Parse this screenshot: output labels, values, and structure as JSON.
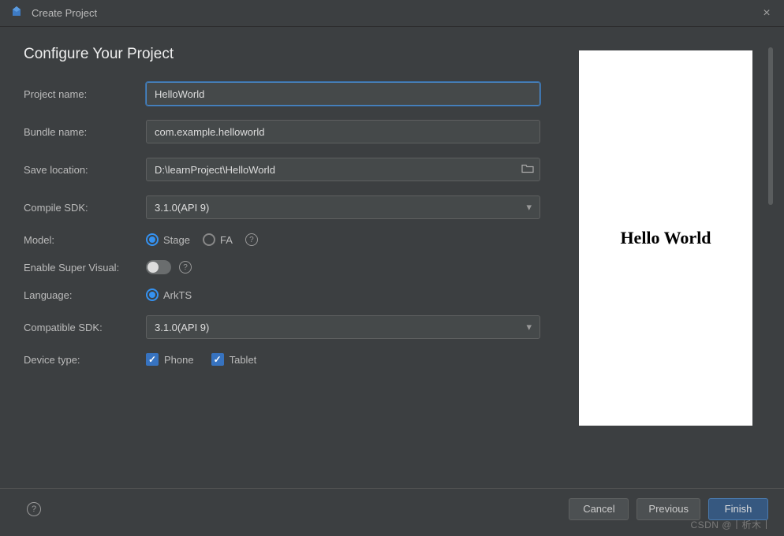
{
  "window": {
    "title": "Create Project"
  },
  "heading": "Configure Your Project",
  "form": {
    "projectName": {
      "label": "Project name:",
      "value": "HelloWorld"
    },
    "bundleName": {
      "label": "Bundle name:",
      "value": "com.example.helloworld"
    },
    "saveLocation": {
      "label": "Save location:",
      "value": "D:\\learnProject\\HelloWorld"
    },
    "compileSdk": {
      "label": "Compile SDK:",
      "value": "3.1.0(API 9)"
    },
    "model": {
      "label": "Model:",
      "option1": "Stage",
      "option2": "FA"
    },
    "enableSuperVisual": {
      "label": "Enable Super Visual:"
    },
    "language": {
      "label": "Language:",
      "option1": "ArkTS"
    },
    "compatibleSdk": {
      "label": "Compatible SDK:",
      "value": "3.1.0(API 9)"
    },
    "deviceType": {
      "label": "Device type:",
      "option1": "Phone",
      "option2": "Tablet"
    }
  },
  "preview": {
    "content": "Hello World"
  },
  "footer": {
    "cancel": "Cancel",
    "previous": "Previous",
    "finish": "Finish"
  },
  "watermark": "CSDN @丨析木丨"
}
